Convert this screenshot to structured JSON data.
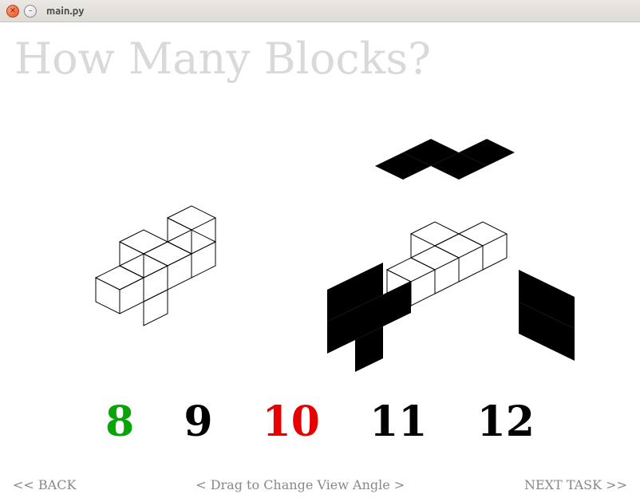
{
  "window": {
    "title": "main.py"
  },
  "question": "How Many Blocks?",
  "answers": [
    {
      "value": "8",
      "state": "correct"
    },
    {
      "value": "9",
      "state": "default"
    },
    {
      "value": "10",
      "state": "wrong"
    },
    {
      "value": "11",
      "state": "default"
    },
    {
      "value": "12",
      "state": "default"
    }
  ],
  "footer": {
    "back": "<< BACK",
    "hint": "< Drag to Change View Angle >",
    "next": "NEXT TASK >>"
  },
  "colors": {
    "correct": "#0aa40a",
    "wrong": "#e60000",
    "default": "#000000",
    "faded": "#d9d9d9"
  }
}
